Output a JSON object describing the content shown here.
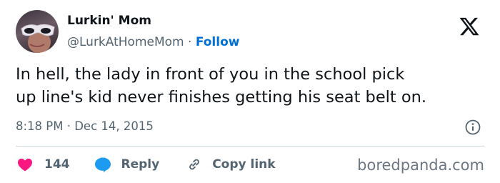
{
  "author": {
    "name": "Lurkin' Mom",
    "handle": "@LurkAtHomeMom",
    "separator": "·",
    "follow_label": "Follow"
  },
  "tweet": {
    "text": "In hell, the lady in front of you in the school pick\nup line's kid never finishes getting his seat belt on.",
    "timestamp": "8:18 PM · Dec 14, 2015"
  },
  "actions": {
    "likes_count": "144",
    "reply_label": "Reply",
    "copy_link_label": "Copy link"
  },
  "watermark": "boredpanda.com",
  "colors": {
    "text": "#0f1419",
    "secondary": "#536471",
    "link": "#006fd6",
    "heart": "#f91880",
    "reply_bubble": "#1d9bf0",
    "divider": "#cfd9de"
  },
  "icons": [
    "x-logo-icon",
    "info-icon",
    "heart-icon",
    "reply-icon",
    "link-icon"
  ]
}
